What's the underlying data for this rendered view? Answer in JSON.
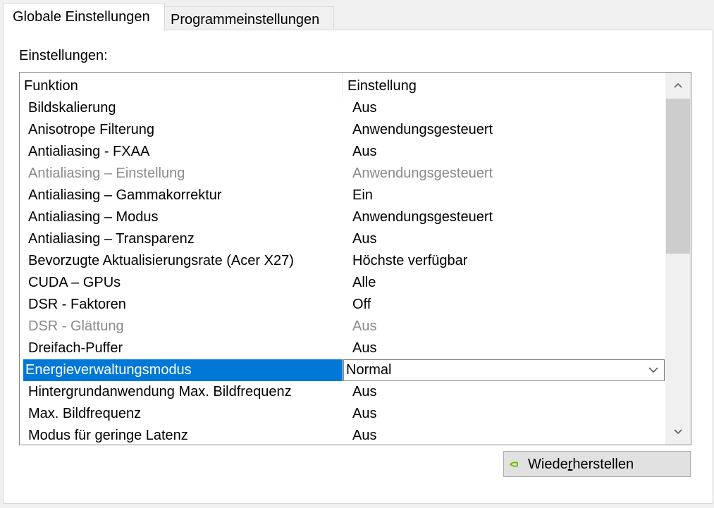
{
  "tabs": [
    {
      "label": "Globale Einstellungen",
      "active": true
    },
    {
      "label": "Programmeinstellungen",
      "active": false
    }
  ],
  "settings_label": "Einstellungen:",
  "table": {
    "columns": [
      "Funktion",
      "Einstellung"
    ],
    "rows": [
      {
        "feature": "Bildskalierung",
        "value": "Aus",
        "disabled": false
      },
      {
        "feature": "Anisotrope Filterung",
        "value": "Anwendungsgesteuert",
        "disabled": false
      },
      {
        "feature": "Antialiasing - FXAA",
        "value": "Aus",
        "disabled": false
      },
      {
        "feature": "Antialiasing – Einstellung",
        "value": "Anwendungsgesteuert",
        "disabled": true
      },
      {
        "feature": "Antialiasing – Gammakorrektur",
        "value": "Ein",
        "disabled": false
      },
      {
        "feature": "Antialiasing – Modus",
        "value": "Anwendungsgesteuert",
        "disabled": false
      },
      {
        "feature": "Antialiasing – Transparenz",
        "value": "Aus",
        "disabled": false
      },
      {
        "feature": "Bevorzugte Aktualisierungsrate (Acer X27)",
        "value": "Höchste verfügbar",
        "disabled": false
      },
      {
        "feature": "CUDA – GPUs",
        "value": "Alle",
        "disabled": false
      },
      {
        "feature": "DSR - Faktoren",
        "value": "Off",
        "disabled": false
      },
      {
        "feature": "DSR - Glättung",
        "value": "Aus",
        "disabled": true
      },
      {
        "feature": "Dreifach-Puffer",
        "value": "Aus",
        "disabled": false
      },
      {
        "feature": "Energieverwaltungsmodus",
        "value": "Normal",
        "disabled": false,
        "selected": true
      },
      {
        "feature": "Hintergrundanwendung Max. Bildfrequenz",
        "value": "Aus",
        "disabled": false
      },
      {
        "feature": "Max. Bildfrequenz",
        "value": "Aus",
        "disabled": false
      },
      {
        "feature": "Modus für geringe Latenz",
        "value": "Aus",
        "disabled": false
      }
    ]
  },
  "restore_button": {
    "pre": "Wiede",
    "mnemonic": "r",
    "post": "herstellen"
  },
  "colors": {
    "selection": "#0078d7",
    "disabled_text": "#8a8a8a",
    "nvidia_green": "#76b900"
  },
  "icons": {
    "scroll_up": "chevron-up-icon",
    "scroll_down": "chevron-down-icon",
    "dropdown": "chevron-down-icon",
    "restore": "nvidia-logo-icon"
  }
}
